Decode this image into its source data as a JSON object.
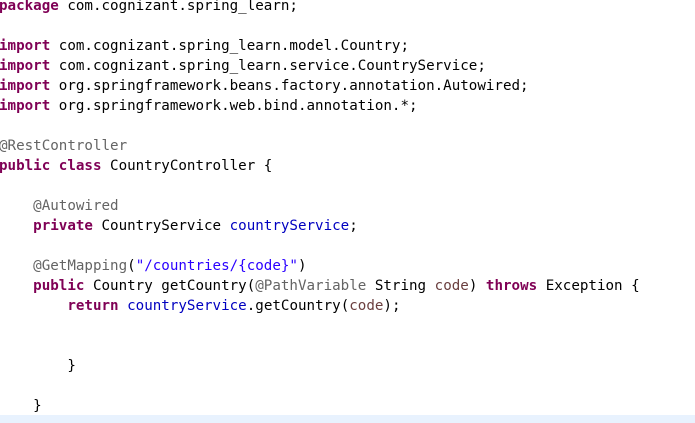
{
  "editor": {
    "lines": {
      "package_kw": "package",
      "package_name": " com.cognizant.spring_learn;",
      "import_kw": "import",
      "import1": " com.cognizant.spring_learn.model.Country;",
      "import2": " com.cognizant.spring_learn.service.CountryService;",
      "import3": " org.springframework.beans.factory.annotation.Autowired;",
      "import4": " org.springframework.web.bind.annotation.*;",
      "rest_controller": "@RestController",
      "public_kw": "public",
      "class_kw": "class",
      "class_name": " CountryController {",
      "autowired": "@Autowired",
      "private_kw": "private",
      "field_type": " CountryService ",
      "field_name": "countryService",
      "semicolon": ";",
      "get_mapping": "@GetMapping",
      "paren_open": "(",
      "mapping_path": "\"/countries/{code}\"",
      "paren_close": ")",
      "return_type": " Country getCountry(",
      "path_variable": "@PathVariable",
      "param_type": " String ",
      "param_name": "code",
      "param_close": ") ",
      "throws_kw": "throws",
      "exception": " Exception {",
      "return_kw": "return",
      "call_target": "countryService",
      "call_method": ".getCountry(",
      "call_arg": "code",
      "call_end": ");",
      "method_close": "}",
      "class_close": "}"
    }
  },
  "colors": {
    "keyword": "#7f0055",
    "annotation": "#646464",
    "field": "#0000c0",
    "string": "#2a00ff",
    "parameter": "#6a3e3e"
  }
}
